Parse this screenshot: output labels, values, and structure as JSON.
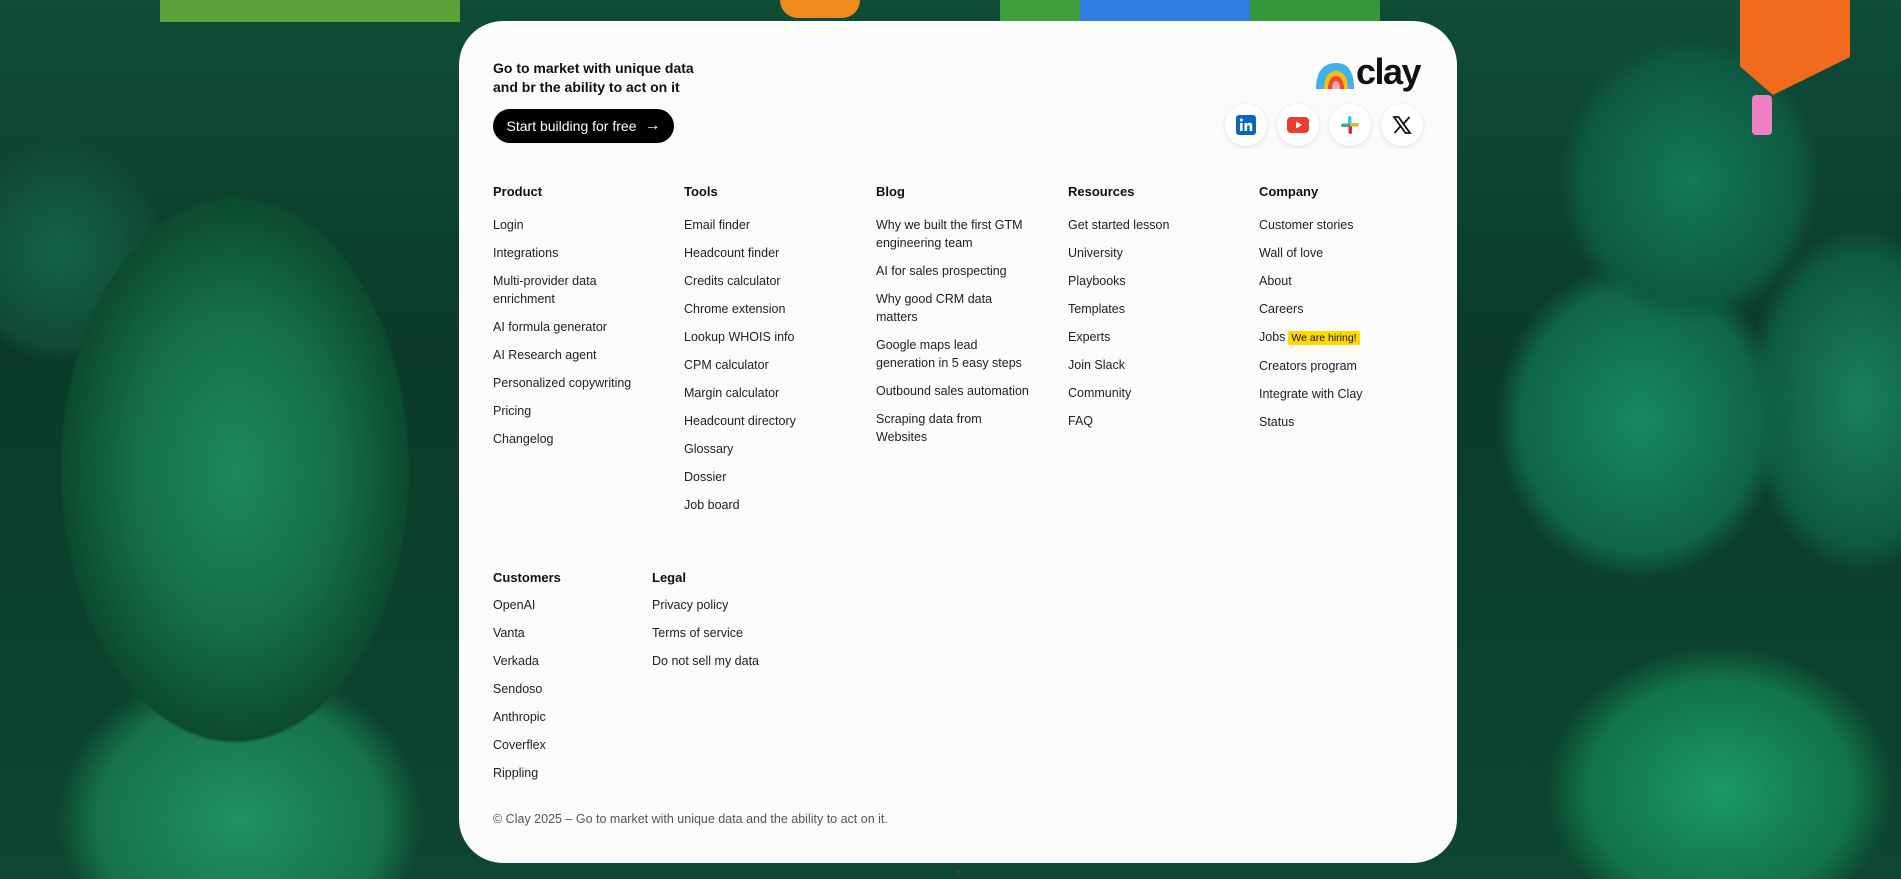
{
  "hero": {
    "tagline_line1": "Go to market with unique data",
    "tagline_line2": "and br the ability to act on it",
    "cta_label": "Start building for free",
    "cta_arrow": "→"
  },
  "brand": {
    "logo_text": "clay",
    "colors": {
      "accent_black": "#000000",
      "badge_yellow": "#ffd800",
      "panel_bg": "#fbfbfa"
    }
  },
  "social": [
    {
      "name": "linkedin-icon"
    },
    {
      "name": "youtube-icon"
    },
    {
      "name": "slack-icon"
    },
    {
      "name": "x-icon"
    }
  ],
  "columns": {
    "product": {
      "title": "Product",
      "links": [
        "Login",
        "Integrations",
        "Multi-provider data enrichment",
        "AI formula generator",
        "AI Research agent",
        "Personalized copywriting",
        "Pricing",
        "Changelog"
      ]
    },
    "tools": {
      "title": "Tools",
      "links": [
        "Email finder",
        "Headcount finder",
        "Credits calculator",
        "Chrome extension",
        "Lookup WHOIS info",
        "CPM calculator",
        "Margin calculator",
        "Headcount directory",
        "Glossary",
        "Dossier",
        "Job board"
      ]
    },
    "blog": {
      "title": "Blog",
      "links": [
        "Why we built the first GTM engineering team",
        "AI for sales prospecting",
        "Why good CRM data matters",
        "Google maps lead generation in 5 easy steps",
        "Outbound sales automation",
        "Scraping data from Websites"
      ]
    },
    "resources": {
      "title": "Resources",
      "links": [
        "Get started lesson",
        "University",
        "Playbooks",
        "Templates",
        "Experts",
        "Join Slack",
        "Community",
        "FAQ"
      ]
    },
    "company": {
      "title": "Company",
      "links": [
        "Customer stories",
        "Wall of love",
        "About",
        "Careers",
        "Jobs",
        "Creators program",
        "Integrate with Clay",
        "Status"
      ],
      "jobs_badge": "We are hiring!"
    },
    "customers": {
      "title": "Customers",
      "links": [
        "OpenAI",
        "Vanta",
        "Verkada",
        "Sendoso",
        "Anthropic",
        "Coverflex",
        "Rippling"
      ]
    },
    "legal": {
      "title": "Legal",
      "links": [
        "Privacy policy",
        "Terms of service",
        "Do not sell my data"
      ]
    }
  },
  "footer": {
    "copyright": "© Clay 2025 – Go to market with unique data and the ability to act on it."
  }
}
